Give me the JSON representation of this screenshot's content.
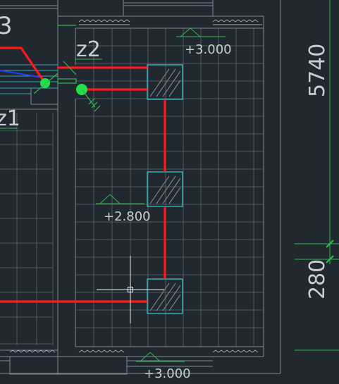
{
  "drawing": {
    "background": "#212830",
    "colors": {
      "wall": "#7e8892",
      "grid": "#5c666f",
      "tile": "#6c7680",
      "pipe": "#ff1a1a",
      "column": "#2fc6c6",
      "valve": "#22e04a",
      "dim": "#2fb84f",
      "label": "#c9cdd1",
      "crosshair": "#eef0f2",
      "level_mark": "#2fb84f"
    },
    "labels": {
      "partial_tag": "3",
      "z2": "z2",
      "z1": "z1",
      "elevation_top": "+3.000",
      "elevation_mid": "+2.800",
      "elevation_bottom": "+3.000",
      "dim_vertical_long": "5740",
      "dim_vertical_short": "280"
    },
    "icons": {
      "cursor": "crosshair-cursor-icon",
      "level": "level-marker-icon",
      "valve": "valve-node-icon",
      "break_line": "break-line-icon"
    }
  }
}
